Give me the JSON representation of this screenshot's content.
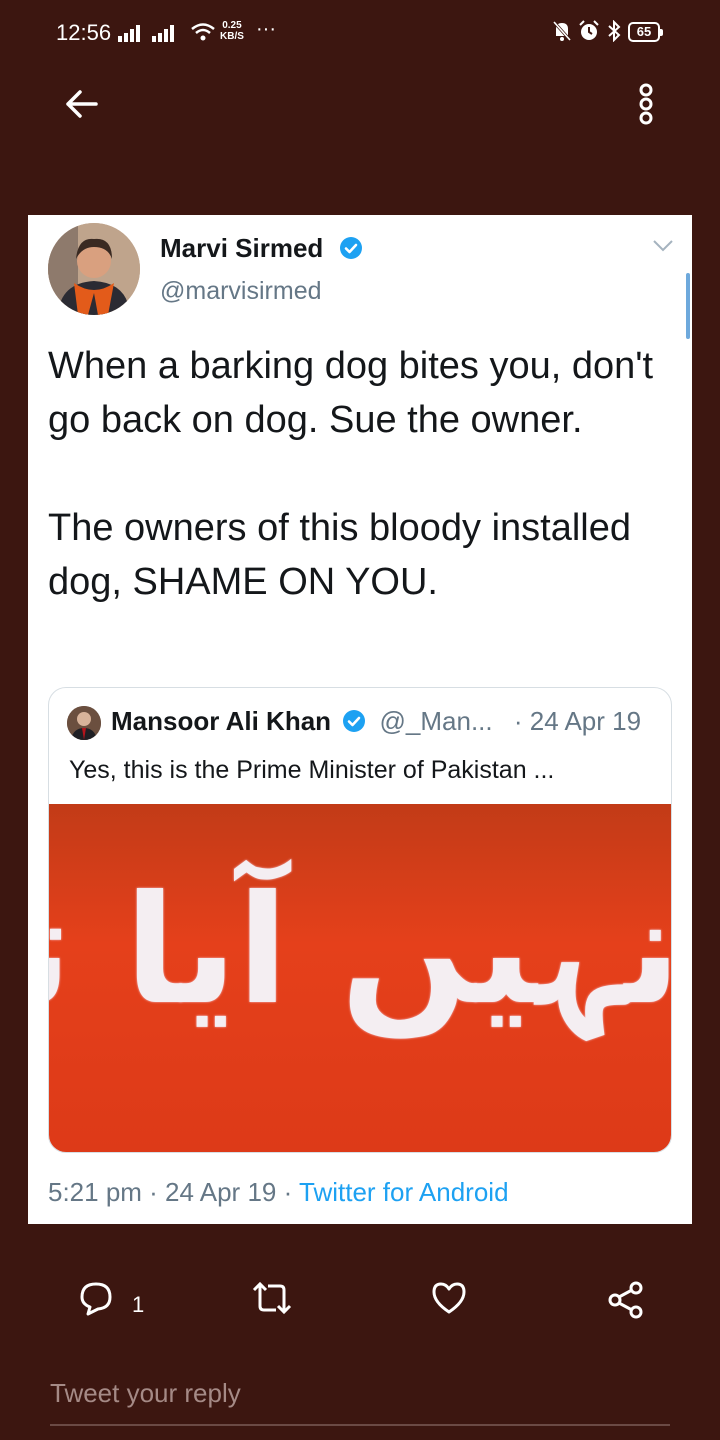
{
  "status_bar": {
    "time": "12:56",
    "net_speed_value": "0.25",
    "net_speed_unit": "KB/S",
    "overflow": "···",
    "battery": "65"
  },
  "tweet": {
    "author_name": "Marvi Sirmed",
    "author_handle": "@marvisirmed",
    "text": "When a barking dog bites you, don't go back on dog. Sue the owner.\n\nThe owners of this bloody installed dog, SHAME ON YOU.",
    "timestamp": "5:21 pm · 24 Apr 19 · ",
    "source": "Twitter for Android"
  },
  "quoted_tweet": {
    "author_name": "Mansoor Ali Khan",
    "author_handle": "@_Man...",
    "date": "· 24 Apr 19",
    "text": "Yes, this is the Prime Minister of Pakistan ...",
    "image_text": "نہیں آیا تھا"
  },
  "actions": {
    "reply_count": "1"
  },
  "reply_box": {
    "placeholder": "Tweet your reply"
  },
  "colors": {
    "background": "#3c1610",
    "link": "#1da1f2",
    "verified": "#1da1f2"
  }
}
